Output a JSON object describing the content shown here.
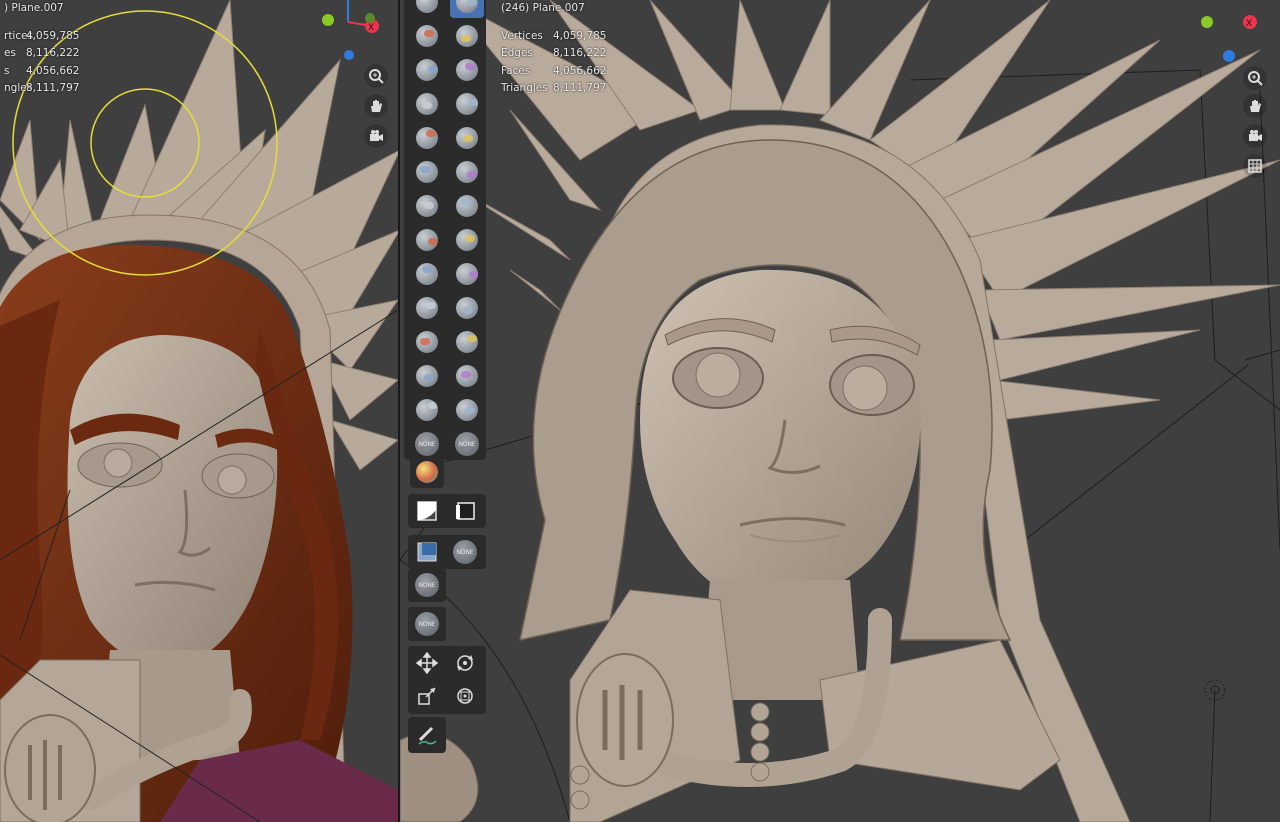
{
  "left_viewport": {
    "object_title": ") Plane.007",
    "stats": [
      {
        "label": "rtices",
        "value": "4,059,785"
      },
      {
        "label": "es",
        "value": "8,116,222"
      },
      {
        "label": "s",
        "value": "4,056,662"
      },
      {
        "label": "ngles",
        "value": "8,111,797"
      }
    ],
    "gizmo_x_label": "X"
  },
  "right_viewport": {
    "object_title": "(246) Plane.007",
    "stats": [
      {
        "label": "Vertices",
        "value": "4,059,785"
      },
      {
        "label": "Edges",
        "value": "8,116,222"
      },
      {
        "label": "Faces",
        "value": "4,056,662"
      },
      {
        "label": "Triangles",
        "value": "8,111,797"
      }
    ],
    "gizmo_x_label": "X"
  },
  "toolbar": {
    "none_label": "NONE",
    "active_tool": "draw-sharp-brush",
    "brush_tools": [
      "draw-brush",
      "draw-sharp-brush",
      "clay-brush",
      "clay-strips-brush",
      "clay-thumb-brush",
      "layer-brush",
      "inflate-brush",
      "blob-brush",
      "crease-brush",
      "smooth-brush",
      "flatten-brush",
      "fill-brush",
      "scrape-brush",
      "multiplane-scrape-brush",
      "pinch-brush",
      "grab-brush",
      "elastic-deform-brush",
      "snake-hook-brush",
      "thumb-brush",
      "pose-brush",
      "nudge-brush",
      "rotate-brush",
      "slide-relax-brush",
      "boundary-brush",
      "cloth-brush",
      "simplify-brush"
    ]
  },
  "colors": {
    "viewport_bg": "#3f3f3f",
    "clay": "#b9ab9c",
    "hair": "#7a3518",
    "active_tool": "#4772b3",
    "brush_circle": "#e5dc3a",
    "gizmo_x": "#e8364f",
    "gizmo_y": "#8ac926",
    "gizmo_z": "#2f7ce0"
  }
}
